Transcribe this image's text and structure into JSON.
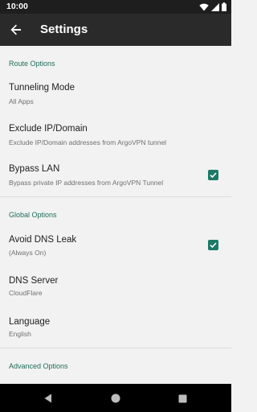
{
  "status_bar": {
    "time": "10:00"
  },
  "app_bar": {
    "title": "Settings"
  },
  "sections": {
    "route": "Route Options",
    "global": "Global Options",
    "advanced": "Advanced Options"
  },
  "items": {
    "tunneling": {
      "title": "Tunneling Mode",
      "summary": "All Apps"
    },
    "exclude": {
      "title": "Exclude IP/Domain",
      "summary": "Exclude IP/Domain addresses from ArgoVPN tunnel"
    },
    "bypass_lan": {
      "title": "Bypass LAN",
      "summary": "Bypass private IP addresses from ArgoVPN Tunnel",
      "checked": true
    },
    "avoid_dns_leak": {
      "title": "Avoid DNS Leak",
      "summary": "(Always On)",
      "checked": true
    },
    "dns_server": {
      "title": "DNS Server",
      "summary": "CloudFlare"
    },
    "language": {
      "title": "Language",
      "summary": "English"
    }
  },
  "colors": {
    "accent": "#1d7a68",
    "section_header": "#1e6e5a",
    "app_bar": "#2a2a2a"
  },
  "icons": {
    "back": "arrow-left-icon",
    "check": "check-icon",
    "wifi": "wifi-icon",
    "cell": "cell-signal-icon",
    "battery": "battery-icon"
  }
}
